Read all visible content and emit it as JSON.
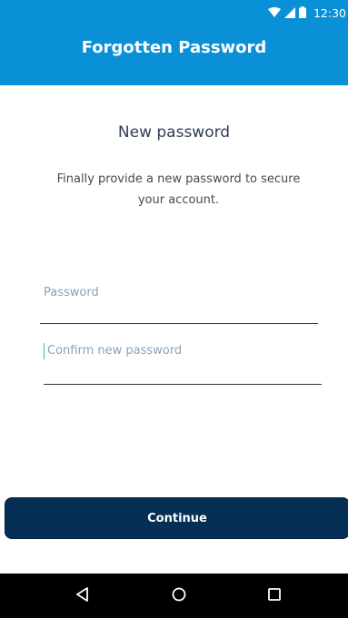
{
  "status_bar": {
    "time": "12:30",
    "icons": [
      "wifi-icon",
      "signal-icon",
      "battery-icon"
    ]
  },
  "app_bar": {
    "title": "Forgotten Password",
    "background_color": "#0990d6"
  },
  "content": {
    "heading": "New password",
    "description": "Finally provide a new password to secure your account."
  },
  "form": {
    "password": {
      "value": "",
      "placeholder": "Password"
    },
    "confirm_password": {
      "value": "",
      "placeholder": "Confirm new password"
    }
  },
  "actions": {
    "continue_label": "Continue",
    "button_color": "#062f55"
  },
  "nav_bar": {
    "icons": [
      "back-icon",
      "home-icon",
      "recent-apps-icon"
    ]
  }
}
